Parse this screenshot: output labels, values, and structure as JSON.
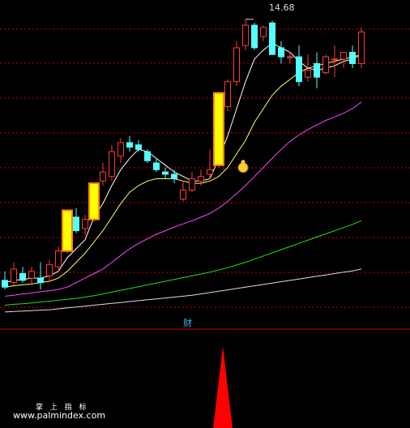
{
  "chart_data": {
    "type": "candlestick",
    "price_annotation": "14.68",
    "panel_label": "财",
    "watermark_cn": "掌 上 指 标",
    "watermark_url": "www.palmindex.com",
    "ylim": [
      8.0,
      15.0
    ],
    "colors": {
      "up": "#ff3a3a",
      "down": "#54ffff",
      "highlight_fill": "#ffff00",
      "highlight_edge": "#ff8800",
      "ma_short": "#ffffff",
      "ma_mid": "#ffff66",
      "ma_long": "#ff44ff",
      "ma_longer": "#22dd22",
      "ma_longest": "#dddddd",
      "grid": "#cc0000",
      "signal": "#ff0000",
      "coin": "#ffcc33"
    },
    "candles": [
      {
        "o": 8.9,
        "h": 9.1,
        "l": 8.7,
        "c": 8.75
      },
      {
        "o": 8.85,
        "h": 9.3,
        "l": 8.8,
        "c": 9.15
      },
      {
        "o": 9.05,
        "h": 9.2,
        "l": 8.85,
        "c": 8.9
      },
      {
        "o": 8.95,
        "h": 9.2,
        "l": 8.8,
        "c": 9.1
      },
      {
        "o": 8.95,
        "h": 9.3,
        "l": 8.7,
        "c": 8.85
      },
      {
        "o": 9.0,
        "h": 9.35,
        "l": 8.9,
        "c": 9.25
      },
      {
        "o": 9.2,
        "h": 9.65,
        "l": 9.1,
        "c": 9.55
      },
      {
        "o": 9.55,
        "h": 10.45,
        "l": 9.5,
        "c": 10.45,
        "highlight": true
      },
      {
        "o": 10.3,
        "h": 10.5,
        "l": 9.95,
        "c": 10.0
      },
      {
        "o": 10.05,
        "h": 10.35,
        "l": 9.9,
        "c": 10.25
      },
      {
        "o": 10.25,
        "h": 11.05,
        "l": 10.2,
        "c": 11.05,
        "highlight": true
      },
      {
        "o": 11.1,
        "h": 11.5,
        "l": 11.0,
        "c": 11.3
      },
      {
        "o": 11.2,
        "h": 11.9,
        "l": 11.1,
        "c": 11.75
      },
      {
        "o": 11.65,
        "h": 12.05,
        "l": 11.5,
        "c": 11.95
      },
      {
        "o": 11.95,
        "h": 12.1,
        "l": 11.75,
        "c": 11.85
      },
      {
        "o": 11.9,
        "h": 12.0,
        "l": 11.75,
        "c": 11.8
      },
      {
        "o": 11.75,
        "h": 11.8,
        "l": 11.5,
        "c": 11.55
      },
      {
        "o": 11.5,
        "h": 11.6,
        "l": 11.3,
        "c": 11.35
      },
      {
        "o": 11.3,
        "h": 11.4,
        "l": 11.15,
        "c": 11.25
      },
      {
        "o": 11.25,
        "h": 11.35,
        "l": 11.05,
        "c": 11.15
      },
      {
        "o": 10.7,
        "h": 11.1,
        "l": 10.65,
        "c": 10.9
      },
      {
        "o": 10.9,
        "h": 11.3,
        "l": 10.85,
        "c": 11.15
      },
      {
        "o": 11.1,
        "h": 11.35,
        "l": 11.0,
        "c": 11.2
      },
      {
        "o": 11.25,
        "h": 11.8,
        "l": 11.15,
        "c": 11.35
      },
      {
        "o": 11.45,
        "h": 13.05,
        "l": 11.4,
        "c": 13.05,
        "highlight": true
      },
      {
        "o": 12.75,
        "h": 13.35,
        "l": 12.65,
        "c": 13.3
      },
      {
        "o": 13.3,
        "h": 14.2,
        "l": 13.2,
        "c": 14.05
      },
      {
        "o": 14.1,
        "h": 14.68,
        "l": 14.0,
        "c": 14.55
      },
      {
        "o": 14.55,
        "h": 14.6,
        "l": 14.0,
        "c": 14.05
      },
      {
        "o": 14.3,
        "h": 14.55,
        "l": 14.2,
        "c": 14.5
      },
      {
        "o": 14.6,
        "h": 14.65,
        "l": 13.9,
        "c": 13.9
      },
      {
        "o": 14.05,
        "h": 14.2,
        "l": 13.7,
        "c": 13.85
      },
      {
        "o": 13.85,
        "h": 13.95,
        "l": 13.7,
        "c": 13.85
      },
      {
        "o": 13.85,
        "h": 14.1,
        "l": 13.2,
        "c": 13.3
      },
      {
        "o": 13.4,
        "h": 13.9,
        "l": 13.3,
        "c": 13.55
      },
      {
        "o": 13.7,
        "h": 13.95,
        "l": 13.15,
        "c": 13.4
      },
      {
        "o": 13.5,
        "h": 13.9,
        "l": 13.45,
        "c": 13.85
      },
      {
        "o": 13.8,
        "h": 14.1,
        "l": 13.4,
        "c": 13.8
      },
      {
        "o": 13.8,
        "h": 13.95,
        "l": 13.6,
        "c": 13.95
      },
      {
        "o": 13.95,
        "h": 14.1,
        "l": 13.6,
        "c": 13.7
      },
      {
        "o": 13.7,
        "h": 14.5,
        "l": 13.6,
        "c": 14.4
      }
    ],
    "ma_short": [
      8.85,
      8.9,
      8.92,
      8.95,
      8.95,
      9.0,
      9.1,
      9.4,
      9.6,
      9.8,
      10.3,
      10.6,
      11.0,
      11.35,
      11.6,
      11.8,
      11.75,
      11.6,
      11.45,
      11.3,
      11.2,
      11.1,
      11.1,
      11.15,
      11.6,
      12.1,
      12.7,
      13.3,
      13.8,
      14.0,
      14.15,
      14.05,
      13.95,
      13.75,
      13.6,
      13.55,
      13.6,
      13.65,
      13.75,
      13.8,
      13.9
    ],
    "ma_mid": [
      8.75,
      8.78,
      8.8,
      8.82,
      8.85,
      8.88,
      8.95,
      9.1,
      9.3,
      9.5,
      9.75,
      10.0,
      10.3,
      10.6,
      10.85,
      11.0,
      11.1,
      11.15,
      11.15,
      11.15,
      11.1,
      11.05,
      11.05,
      11.1,
      11.2,
      11.4,
      11.7,
      12.0,
      12.4,
      12.7,
      13.0,
      13.2,
      13.35,
      13.5,
      13.6,
      13.65,
      13.7,
      13.75,
      13.8,
      13.85,
      13.9
    ],
    "ma_long": [
      8.55,
      8.57,
      8.6,
      8.62,
      8.65,
      8.67,
      8.7,
      8.75,
      8.85,
      8.95,
      9.05,
      9.15,
      9.3,
      9.45,
      9.6,
      9.72,
      9.82,
      9.92,
      10.0,
      10.08,
      10.15,
      10.22,
      10.3,
      10.38,
      10.5,
      10.65,
      10.82,
      11.0,
      11.2,
      11.4,
      11.6,
      11.8,
      11.98,
      12.12,
      12.24,
      12.34,
      12.44,
      12.52,
      12.6,
      12.7,
      12.85
    ],
    "ma_longer": [
      8.35,
      8.37,
      8.38,
      8.4,
      8.42,
      8.44,
      8.46,
      8.48,
      8.5,
      8.53,
      8.56,
      8.6,
      8.64,
      8.68,
      8.72,
      8.76,
      8.8,
      8.84,
      8.88,
      8.92,
      8.96,
      9.0,
      9.04,
      9.08,
      9.13,
      9.18,
      9.24,
      9.3,
      9.37,
      9.44,
      9.51,
      9.58,
      9.65,
      9.72,
      9.79,
      9.86,
      9.93,
      10.0,
      10.07,
      10.14,
      10.22
    ],
    "ma_longest": [
      8.2,
      8.21,
      8.22,
      8.23,
      8.24,
      8.25,
      8.27,
      8.29,
      8.31,
      8.33,
      8.35,
      8.37,
      8.39,
      8.41,
      8.43,
      8.45,
      8.47,
      8.49,
      8.51,
      8.53,
      8.55,
      8.57,
      8.6,
      8.63,
      8.66,
      8.69,
      8.72,
      8.75,
      8.78,
      8.81,
      8.84,
      8.87,
      8.9,
      8.93,
      8.96,
      8.99,
      9.02,
      9.05,
      9.08,
      9.11,
      9.15
    ],
    "signal_bar_index": 24,
    "signal_value": 1
  }
}
